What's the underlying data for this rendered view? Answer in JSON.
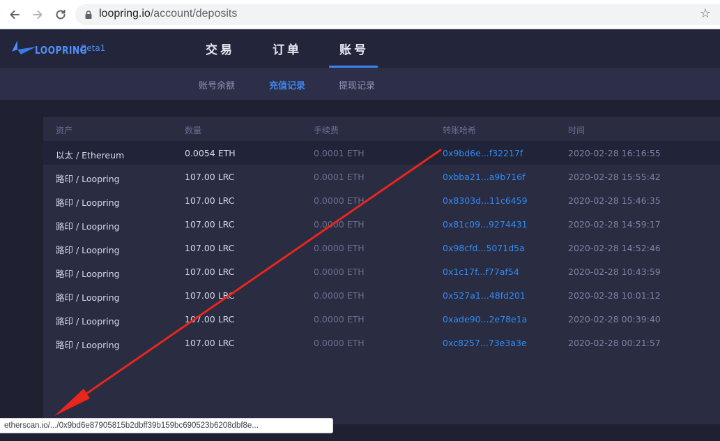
{
  "browser": {
    "url_host": "loopring.io",
    "url_path": "/account/deposits"
  },
  "header": {
    "logo_text": "LOOPRING",
    "beta": "Beta1",
    "tabs": [
      {
        "label": "交易"
      },
      {
        "label": "订单"
      },
      {
        "label": "账号"
      }
    ],
    "active_tab": "账号",
    "accent_color": "#3d84f0"
  },
  "subnav": {
    "items": [
      {
        "label": "账号余额"
      },
      {
        "label": "充值记录"
      },
      {
        "label": "提现记录"
      }
    ],
    "active": "充值记录"
  },
  "table": {
    "columns": [
      "资产",
      "数量",
      "手续费",
      "转账哈希",
      "时间"
    ],
    "rows": [
      {
        "asset": "以太 / Ethereum",
        "amount": "0.0054 ETH",
        "fee": "0.0001 ETH",
        "hash": "0x9bd6e...f32217f",
        "time": "2020-02-28 16:16:55"
      },
      {
        "asset": "路印 / Loopring",
        "amount": "107.00 LRC",
        "fee": "0.0001 ETH",
        "hash": "0xbba21...a9b716f",
        "time": "2020-02-28 15:55:42"
      },
      {
        "asset": "路印 / Loopring",
        "amount": "107.00 LRC",
        "fee": "0.0000 ETH",
        "hash": "0x8303d...11c6459",
        "time": "2020-02-28 15:46:35"
      },
      {
        "asset": "路印 / Loopring",
        "amount": "107.00 LRC",
        "fee": "0.0000 ETH",
        "hash": "0x81c09...9274431",
        "time": "2020-02-28 14:59:17"
      },
      {
        "asset": "路印 / Loopring",
        "amount": "107.00 LRC",
        "fee": "0.0000 ETH",
        "hash": "0x98cfd...5071d5a",
        "time": "2020-02-28 14:52:46"
      },
      {
        "asset": "路印 / Loopring",
        "amount": "107.00 LRC",
        "fee": "0.0000 ETH",
        "hash": "0x1c17f...f77af54",
        "time": "2020-02-28 10:43:59"
      },
      {
        "asset": "路印 / Loopring",
        "amount": "107.00 LRC",
        "fee": "0.0000 ETH",
        "hash": "0x527a1...48fd201",
        "time": "2020-02-28 10:01:12"
      },
      {
        "asset": "路印 / Loopring",
        "amount": "107.00 LRC",
        "fee": "0.0000 ETH",
        "hash": "0xade90...2e78e1a",
        "time": "2020-02-28 00:39:40"
      },
      {
        "asset": "路印 / Loopring",
        "amount": "107.00 LRC",
        "fee": "0.0000 ETH",
        "hash": "0xc8257...73e3a3e",
        "time": "2020-02-28 00:21:57"
      }
    ]
  },
  "status_bar": {
    "text": "etherscan.io/.../0x9bd6e87905815b2dbff39b159bc690523b6208dbf8e..."
  },
  "annotation": {
    "arrow_color": "#e8261c"
  }
}
